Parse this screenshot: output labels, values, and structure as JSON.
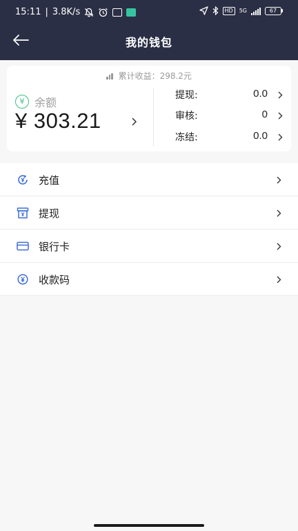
{
  "status_bar": {
    "time": "15:11",
    "network_speed": "3.8K/s",
    "network_type": "5G",
    "battery": "67"
  },
  "header": {
    "title": "我的钱包"
  },
  "wallet": {
    "cumulative_earnings": "累计收益：298.2元",
    "balance_label": "余额",
    "balance_amount": "¥ 303.21",
    "stats": [
      {
        "label": "提现:",
        "value": "0.0"
      },
      {
        "label": "审核:",
        "value": "0"
      },
      {
        "label": "冻结:",
        "value": "0.0"
      }
    ]
  },
  "menu": {
    "items": [
      {
        "label": "充值",
        "icon": "recharge-icon"
      },
      {
        "label": "提现",
        "icon": "withdraw-icon"
      },
      {
        "label": "银行卡",
        "icon": "bank-card-icon"
      },
      {
        "label": "收款码",
        "icon": "payment-code-icon"
      }
    ]
  },
  "colors": {
    "header_bg": "#2b2f45",
    "icon_blue": "#3f6fd6",
    "balance_green": "#3cbf7f",
    "page_bg": "#f7f7f7"
  }
}
